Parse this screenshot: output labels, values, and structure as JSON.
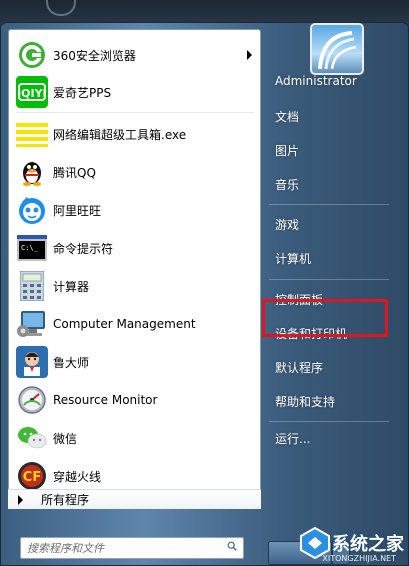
{
  "programs": [
    {
      "label": "360安全浏览器",
      "icon": "browser-360-icon",
      "has_submenu": true
    },
    {
      "label": "爱奇艺PPS",
      "icon": "iqiyi-icon",
      "has_submenu": false
    },
    {
      "label": "网络编辑超级工具箱.exe",
      "icon": "editor-toolbox-icon",
      "has_submenu": false
    },
    {
      "label": "腾讯QQ",
      "icon": "qq-icon",
      "has_submenu": false
    },
    {
      "label": "阿里旺旺",
      "icon": "aliwangwang-icon",
      "has_submenu": false
    },
    {
      "label": "命令提示符",
      "icon": "cmd-icon",
      "has_submenu": false
    },
    {
      "label": "计算器",
      "icon": "calculator-icon",
      "has_submenu": false
    },
    {
      "label": "Computer Management",
      "icon": "computer-management-icon",
      "has_submenu": false
    },
    {
      "label": "鲁大师",
      "icon": "ludashi-icon",
      "has_submenu": false
    },
    {
      "label": "Resource Monitor",
      "icon": "resource-monitor-icon",
      "has_submenu": false
    },
    {
      "label": "微信",
      "icon": "wechat-icon",
      "has_submenu": false
    },
    {
      "label": "穿越火线",
      "icon": "crossfire-icon",
      "has_submenu": false
    }
  ],
  "all_programs_label": "所有程序",
  "search": {
    "placeholder": "搜索程序和文件"
  },
  "right_pane": {
    "user_name": "Administrator",
    "items": [
      {
        "label": "文档"
      },
      {
        "label": "图片"
      },
      {
        "label": "音乐"
      },
      {
        "label": "游戏"
      },
      {
        "label": "计算机"
      },
      {
        "label": "控制面板",
        "highlighted": true
      },
      {
        "label": "设备和打印机"
      },
      {
        "label": "默认程序"
      },
      {
        "label": "帮助和支持"
      },
      {
        "label": "运行..."
      }
    ]
  },
  "watermark": {
    "text": "系统之家",
    "url": "XITONGZHIJIA.NET"
  },
  "colors": {
    "highlight": "#e3151c",
    "accent_blue": "#3c5f80"
  }
}
